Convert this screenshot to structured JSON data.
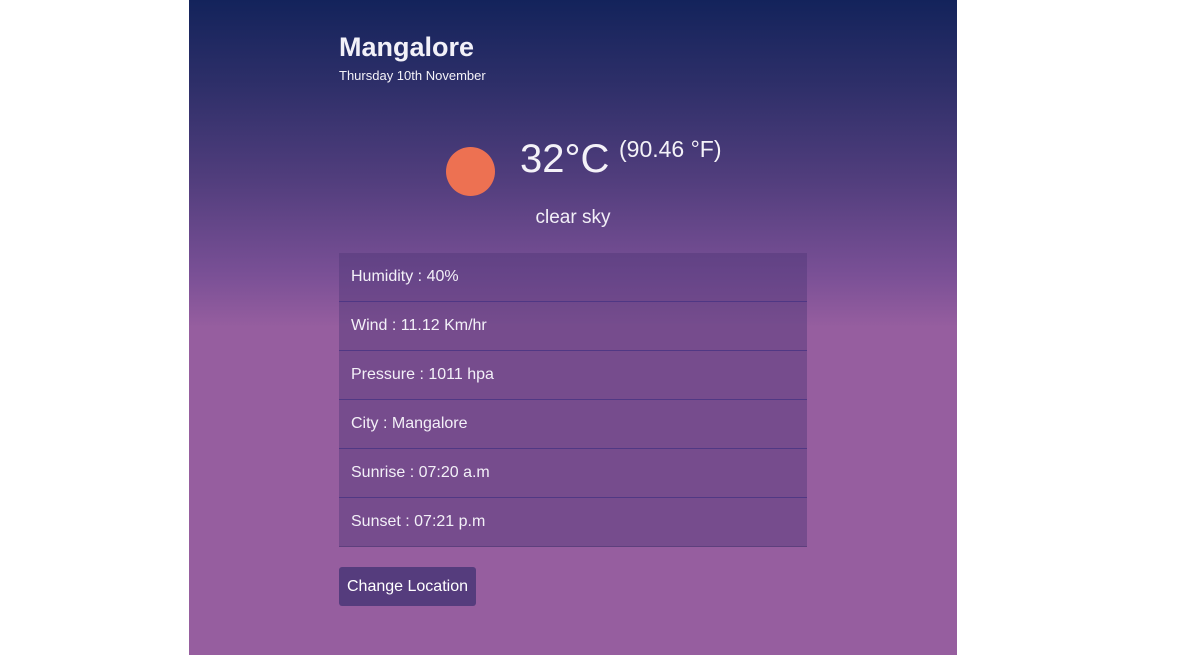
{
  "weather": {
    "city": "Mangalore",
    "date": "Thursday 10th November",
    "temp_c": "32°C",
    "temp_f": "(90.46 °F)",
    "description": "clear sky",
    "icon": "sun-icon",
    "icon_color": "#ed7152"
  },
  "details": [
    {
      "label": "Humidity : 40%"
    },
    {
      "label": "Wind : 11.12 Km/hr"
    },
    {
      "label": "Pressure : 1011 hpa"
    },
    {
      "label": "City : Mangalore"
    },
    {
      "label": "Sunrise : 07:20 a.m"
    },
    {
      "label": "Sunset : 07:21 p.m"
    }
  ],
  "actions": {
    "change_location_label": "Change Location"
  },
  "colors": {
    "gradient_top": "#13235b",
    "gradient_bottom": "#965e9f",
    "button_bg": "#553c7d"
  }
}
